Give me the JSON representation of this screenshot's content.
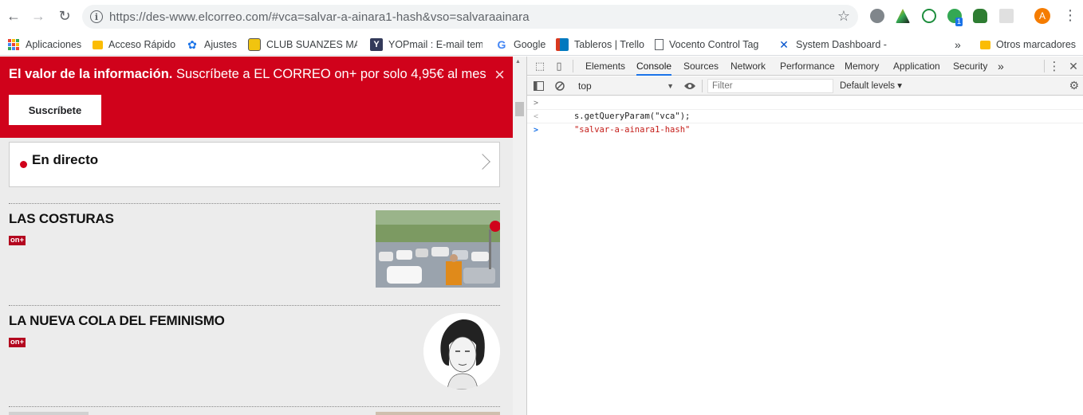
{
  "browser": {
    "url": "https://des-www.elcorreo.com/#vca=salvar-a-ainara1-hash&vso=salvaraainara",
    "avatar_letter": "A",
    "ext_badge": "1",
    "bookmarks": [
      {
        "label": "Aplicaciones",
        "icon": "apps-grid-icon"
      },
      {
        "label": "Acceso Rápido",
        "icon": "folder-icon"
      },
      {
        "label": "Ajustes",
        "icon": "gear-icon"
      },
      {
        "label": "CLUB SUANZES MAD",
        "icon": "club-logo-icon"
      },
      {
        "label": "YOPmail : E-mail tem",
        "icon": "yopmail-icon"
      },
      {
        "label": "Google",
        "icon": "google-icon"
      },
      {
        "label": "Tableros | Trello",
        "icon": "trello-icon"
      },
      {
        "label": "Vocento Control Tag",
        "icon": "page-icon"
      },
      {
        "label": "System Dashboard -",
        "icon": "jira-icon"
      }
    ],
    "more_bookmarks": "»",
    "other_bookmarks": "Otros marcadores"
  },
  "page": {
    "banner": {
      "bold_text": "El valor de la información.",
      "text": " Suscríbete a EL CORREO on+ por solo 4,95€ al mes",
      "button": "Suscríbete",
      "close": "×"
    },
    "live": "En directo",
    "articles": [
      {
        "title": "LAS COSTURAS",
        "badge": "on+"
      },
      {
        "title": "LA NUEVA COLA DEL FEMINISMO",
        "badge": "on+"
      }
    ]
  },
  "devtools": {
    "tabs": [
      "Elements",
      "Console",
      "Sources",
      "Network",
      "Performance",
      "Memory",
      "Application",
      "Security"
    ],
    "active_tab": "Console",
    "more_tabs": "»",
    "context": "top",
    "filter_placeholder": "Filter",
    "levels": "Default levels ▾",
    "console": {
      "command": "s.getQueryParam(\"vca\");",
      "result": "\"salvar-a-ainara1-hash\""
    }
  },
  "colors": {
    "brand_red": "#d0021b",
    "onplus_red": "#b3061f",
    "devtools_active": "#1a73e8"
  }
}
